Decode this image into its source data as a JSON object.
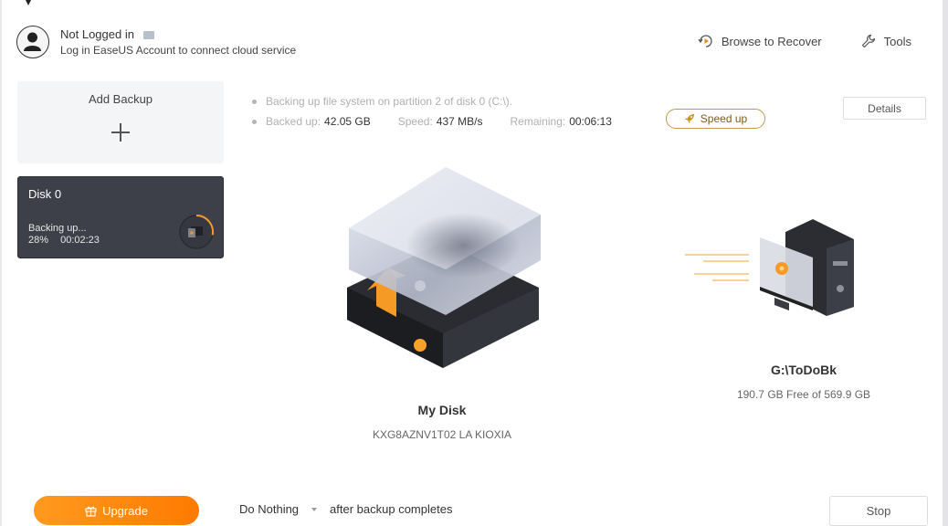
{
  "account": {
    "title": "Not Logged in",
    "subtitle": "Log in EaseUS Account to connect cloud service"
  },
  "top_actions": {
    "browse_to_recover": "Browse to Recover",
    "tools": "Tools"
  },
  "left_panel": {
    "add_backup_label": "Add Backup",
    "task": {
      "name": "Disk 0",
      "status": "Backing up...",
      "percent": "28%",
      "elapsed": "00:02:23",
      "progress_fraction": 0.28
    }
  },
  "status": {
    "message": "Backing up file system on partition 2 of disk 0 (C:\\).",
    "backed_up_label": "Backed up:",
    "backed_up_value": "42.05 GB",
    "speed_label": "Speed:",
    "speed_value": "437 MB/s",
    "remaining_label": "Remaining:",
    "remaining_value": "00:06:13"
  },
  "buttons": {
    "speed_up": "Speed up",
    "details": "Details",
    "upgrade": "Upgrade",
    "stop": "Stop"
  },
  "source": {
    "name": "My Disk",
    "model": "KXG8AZNV1T02 LA KIOXIA"
  },
  "destination": {
    "path": "G:\\ToDoBk",
    "free": "190.7 GB Free of 569.9 GB"
  },
  "after_backup": {
    "selected": "Do Nothing",
    "label": "after backup completes"
  },
  "colors": {
    "accent_orange": "#ff8a00",
    "card_dark": "#3d4049",
    "speedup_border": "#c19a49"
  }
}
